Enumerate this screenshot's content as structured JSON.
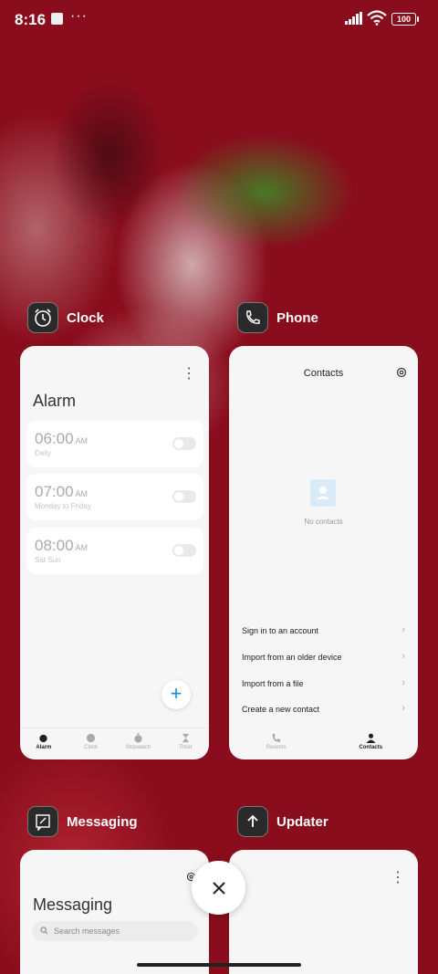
{
  "status_bar": {
    "time": "8:16",
    "dots": "···",
    "battery": "100"
  },
  "clock": {
    "app_name": "Clock",
    "title": "Alarm",
    "alarms": [
      {
        "time": "06:00",
        "ampm": "AM",
        "repeat": "Daily"
      },
      {
        "time": "07:00",
        "ampm": "AM",
        "repeat": "Monday to Friday"
      },
      {
        "time": "08:00",
        "ampm": "AM",
        "repeat": "Sat Sun"
      }
    ],
    "add_label": "+",
    "nav": [
      "Alarm",
      "Clock",
      "Stopwatch",
      "Timer"
    ]
  },
  "phone": {
    "app_name": "Phone",
    "title": "Contacts",
    "empty_text": "No contacts",
    "menu": [
      "Sign in to an account",
      "Import from an older device",
      "Import from a file",
      "Create a new contact"
    ],
    "nav": [
      "Recents",
      "Contacts"
    ]
  },
  "messaging": {
    "app_name": "Messaging",
    "title": "Messaging",
    "search_placeholder": "Search messages"
  },
  "updater": {
    "app_name": "Updater"
  },
  "colors": {
    "accent": "#1a8ad4",
    "wallpaper": "#8a0d1d"
  }
}
